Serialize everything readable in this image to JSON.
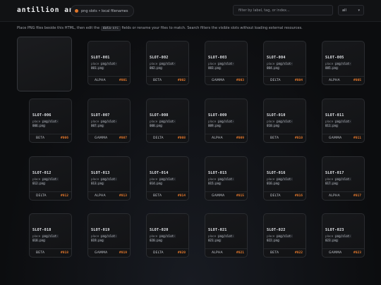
{
  "app": {
    "title": "antillion anthil",
    "badge": "png slots • local filenames",
    "search_placeholder": "filter by label, tag, or index...",
    "filter_value": "all",
    "accent_color": "#e0762b"
  },
  "hint": {
    "before": "Place PNG files beside this HTML, then edit the",
    "code": "data-src",
    "after": "fields or rename your files to match. Search filters the visible slots without loading external resources."
  },
  "slot_place_label": "place",
  "slots": [
    {
      "title": "SLOT-001",
      "file": "png/slot-001.png",
      "tag": "ALPHA",
      "num": "#001"
    },
    {
      "title": "SLOT-002",
      "file": "png/slot-002.png",
      "tag": "BETA",
      "num": "#002"
    },
    {
      "title": "SLOT-003",
      "file": "png/slot-003.png",
      "tag": "GAMMA",
      "num": "#003"
    },
    {
      "title": "SLOT-004",
      "file": "png/slot-004.png",
      "tag": "DELTA",
      "num": "#004"
    },
    {
      "title": "SLOT-005",
      "file": "png/slot-005.png",
      "tag": "ALPHA",
      "num": "#005"
    },
    {
      "title": "SLOT-006",
      "file": "png/slot-006.png",
      "tag": "BETA",
      "num": "#006"
    },
    {
      "title": "SLOT-007",
      "file": "png/slot-007.png",
      "tag": "GAMMA",
      "num": "#007"
    },
    {
      "title": "SLOT-008",
      "file": "png/slot-008.png",
      "tag": "DELTA",
      "num": "#008"
    },
    {
      "title": "SLOT-009",
      "file": "png/slot-009.png",
      "tag": "ALPHA",
      "num": "#009"
    },
    {
      "title": "SLOT-010",
      "file": "png/slot-010.png",
      "tag": "BETA",
      "num": "#010"
    },
    {
      "title": "SLOT-011",
      "file": "png/slot-011.png",
      "tag": "GAMMA",
      "num": "#011"
    },
    {
      "title": "SLOT-012",
      "file": "png/slot-012.png",
      "tag": "DELTA",
      "num": "#012"
    },
    {
      "title": "SLOT-013",
      "file": "png/slot-013.png",
      "tag": "ALPHA",
      "num": "#013"
    },
    {
      "title": "SLOT-014",
      "file": "png/slot-014.png",
      "tag": "BETA",
      "num": "#014"
    },
    {
      "title": "SLOT-015",
      "file": "png/slot-015.png",
      "tag": "GAMMA",
      "num": "#015"
    },
    {
      "title": "SLOT-016",
      "file": "png/slot-016.png",
      "tag": "DELTA",
      "num": "#016"
    },
    {
      "title": "SLOT-017",
      "file": "png/slot-017.png",
      "tag": "ALPHA",
      "num": "#017"
    },
    {
      "title": "SLOT-018",
      "file": "png/slot-018.png",
      "tag": "BETA",
      "num": "#018"
    },
    {
      "title": "SLOT-019",
      "file": "png/slot-019.png",
      "tag": "GAMMA",
      "num": "#019"
    },
    {
      "title": "SLOT-020",
      "file": "png/slot-020.png",
      "tag": "DELTA",
      "num": "#020"
    },
    {
      "title": "SLOT-021",
      "file": "png/slot-021.png",
      "tag": "ALPHA",
      "num": "#021"
    },
    {
      "title": "SLOT-022",
      "file": "png/slot-022.png",
      "tag": "BETA",
      "num": "#022"
    },
    {
      "title": "SLOT-023",
      "file": "png/slot-023.png",
      "tag": "GAMMA",
      "num": "#023"
    }
  ]
}
